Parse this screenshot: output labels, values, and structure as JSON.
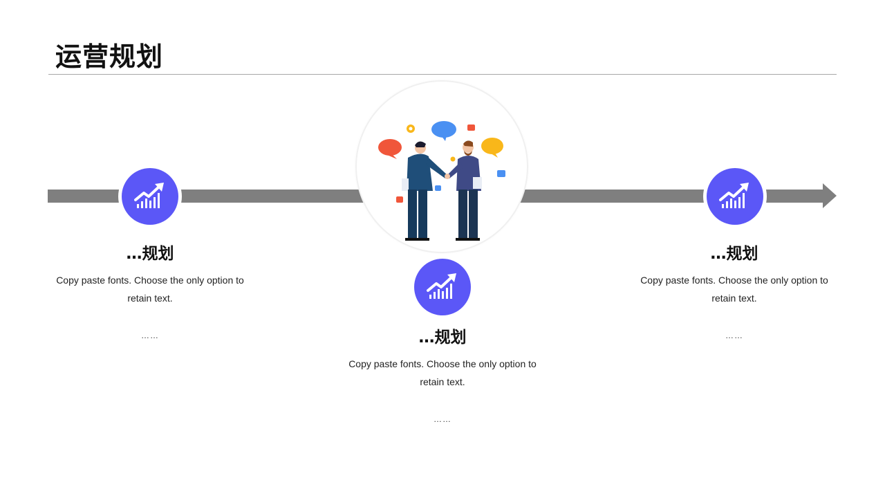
{
  "title": "运营规划",
  "items": [
    {
      "heading": "…规划",
      "body": "Copy paste fonts. Choose the only option to retain text.",
      "more": "……",
      "icon": "growth-chart-icon"
    },
    {
      "heading": "…规划",
      "body": "Copy paste fonts. Choose the only option to retain text.",
      "more": "……",
      "icon": "growth-chart-icon"
    },
    {
      "heading": "…规划",
      "body": "Copy paste fonts. Choose the only option to retain text.",
      "more": "……",
      "icon": "growth-chart-icon"
    }
  ],
  "illustration": "business-handshake-illustration",
  "colors": {
    "accent": "#5b57f7",
    "timeline": "#7f7f7f",
    "rule": "#a6a6a6"
  }
}
